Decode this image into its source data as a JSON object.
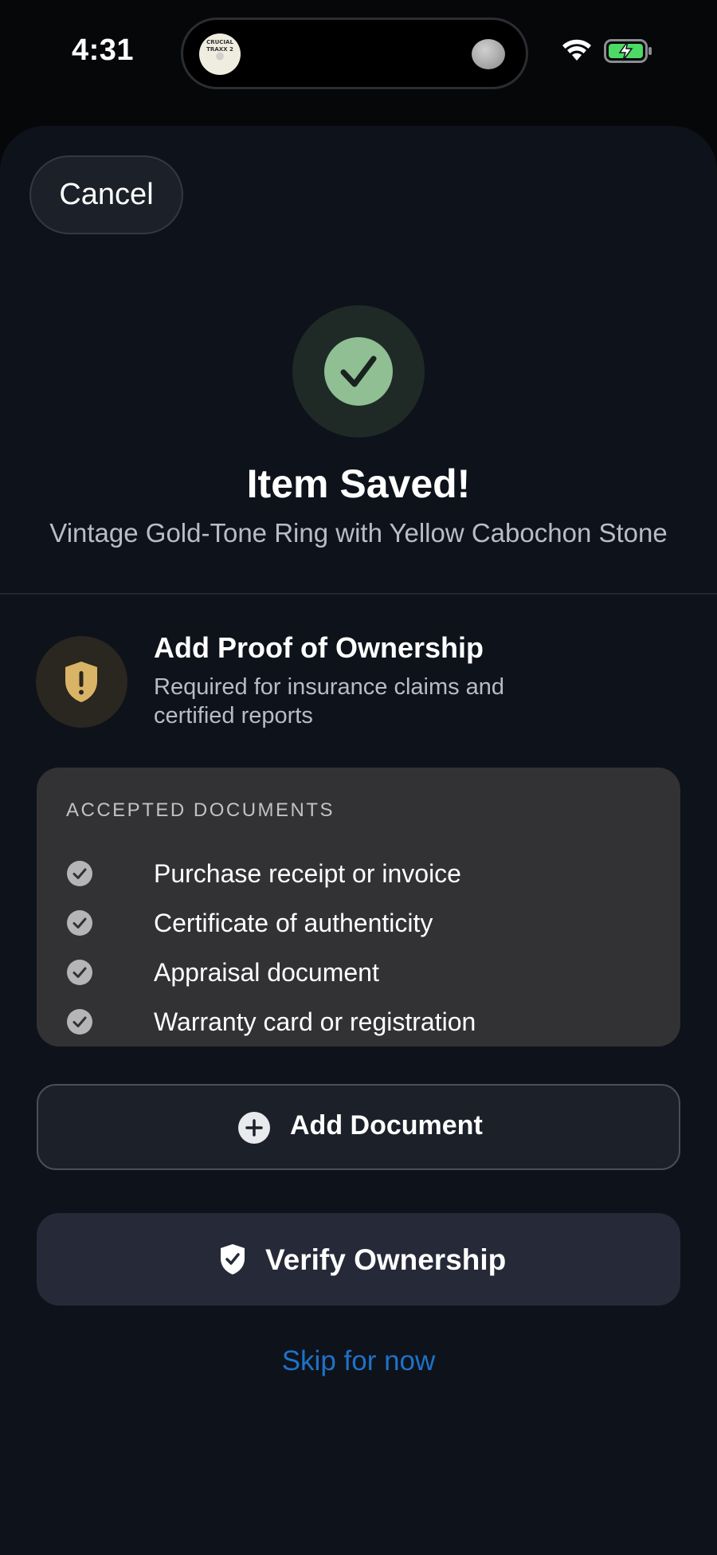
{
  "status_bar": {
    "time": "4:31",
    "now_playing_art_text": "CRUCIAL TRAXX 2"
  },
  "sheet": {
    "cancel_label": "Cancel",
    "success": {
      "title": "Item Saved!",
      "item_name": "Vintage Gold-Tone Ring with Yellow Cabochon Stone"
    },
    "proof": {
      "title": "Add Proof of Ownership",
      "description": "Required for insurance claims and certified reports"
    },
    "accepted_documents": {
      "header": "ACCEPTED DOCUMENTS",
      "items": [
        "Purchase receipt or invoice",
        "Certificate of authenticity",
        "Appraisal document",
        "Warranty card or registration"
      ]
    },
    "add_document_label": "Add Document",
    "verify_label": "Verify Ownership",
    "skip_label": "Skip for now"
  },
  "colors": {
    "sheet_background": "#0e121a",
    "success_green": "#8fbf93",
    "warning_gold": "#d9b466",
    "link_blue": "#1e72c8",
    "card_background": "#323234",
    "battery_green": "#4cd964"
  },
  "icons": {
    "success": "checkmark-icon",
    "proof": "shield-exclamation-icon",
    "document_item": "check-circle-icon",
    "add_document": "plus-circle-icon",
    "verify": "shield-check-icon"
  }
}
